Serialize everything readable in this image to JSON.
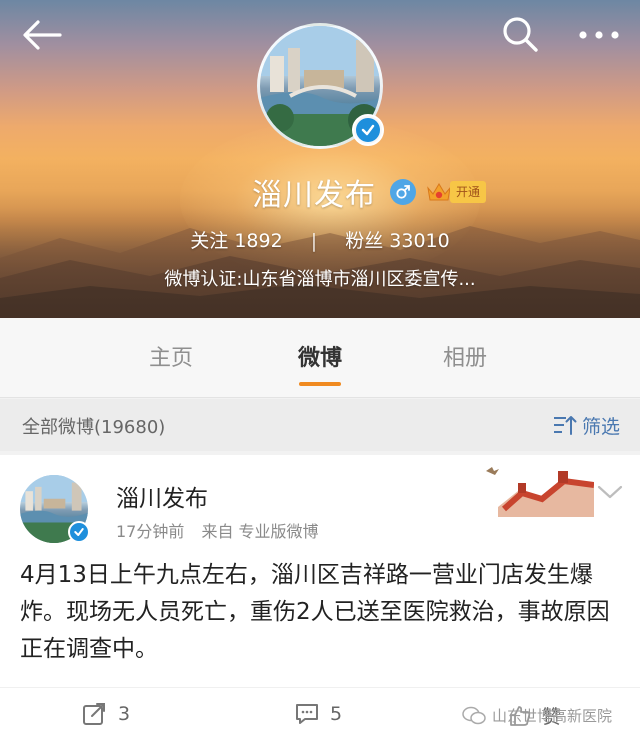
{
  "header": {
    "name": "淄川发布",
    "vip_label": "开通",
    "following_label": "关注",
    "following_count": "1892",
    "stats_separator": "|",
    "followers_label": "粉丝",
    "followers_count": "33010",
    "verification": "微博认证:山东省淄博市淄川区委宣传..."
  },
  "tabs": [
    {
      "label": "主页",
      "active": false
    },
    {
      "label": "微博",
      "active": true
    },
    {
      "label": "相册",
      "active": false
    }
  ],
  "filter_bar": {
    "count_text": "全部微博(19680)",
    "filter_label": "筛选"
  },
  "post": {
    "author": "淄川发布",
    "time": "17分钟前",
    "source": "来自 专业版微博",
    "text": "4月13日上午九点左右，淄川区吉祥路一营业门店发生爆炸。现场无人员死亡，重伤2人已送至医院救治，事故原因正在调查中。",
    "repost_count": "3",
    "comment_count": "5",
    "like_label": "赞"
  },
  "watermark": "山东世博高新医院",
  "colors": {
    "accent": "#f08a20",
    "link": "#4a78b0",
    "verified_blue": "#1e8fdc"
  },
  "icons": {
    "back": "back-arrow-icon",
    "search": "search-icon",
    "more": "more-dots-icon",
    "gender": "male-icon",
    "vip": "crown-icon",
    "filter": "filter-icon",
    "repost": "repost-icon",
    "comment": "comment-icon",
    "like": "like-icon",
    "dropdown": "chevron-down-icon"
  }
}
